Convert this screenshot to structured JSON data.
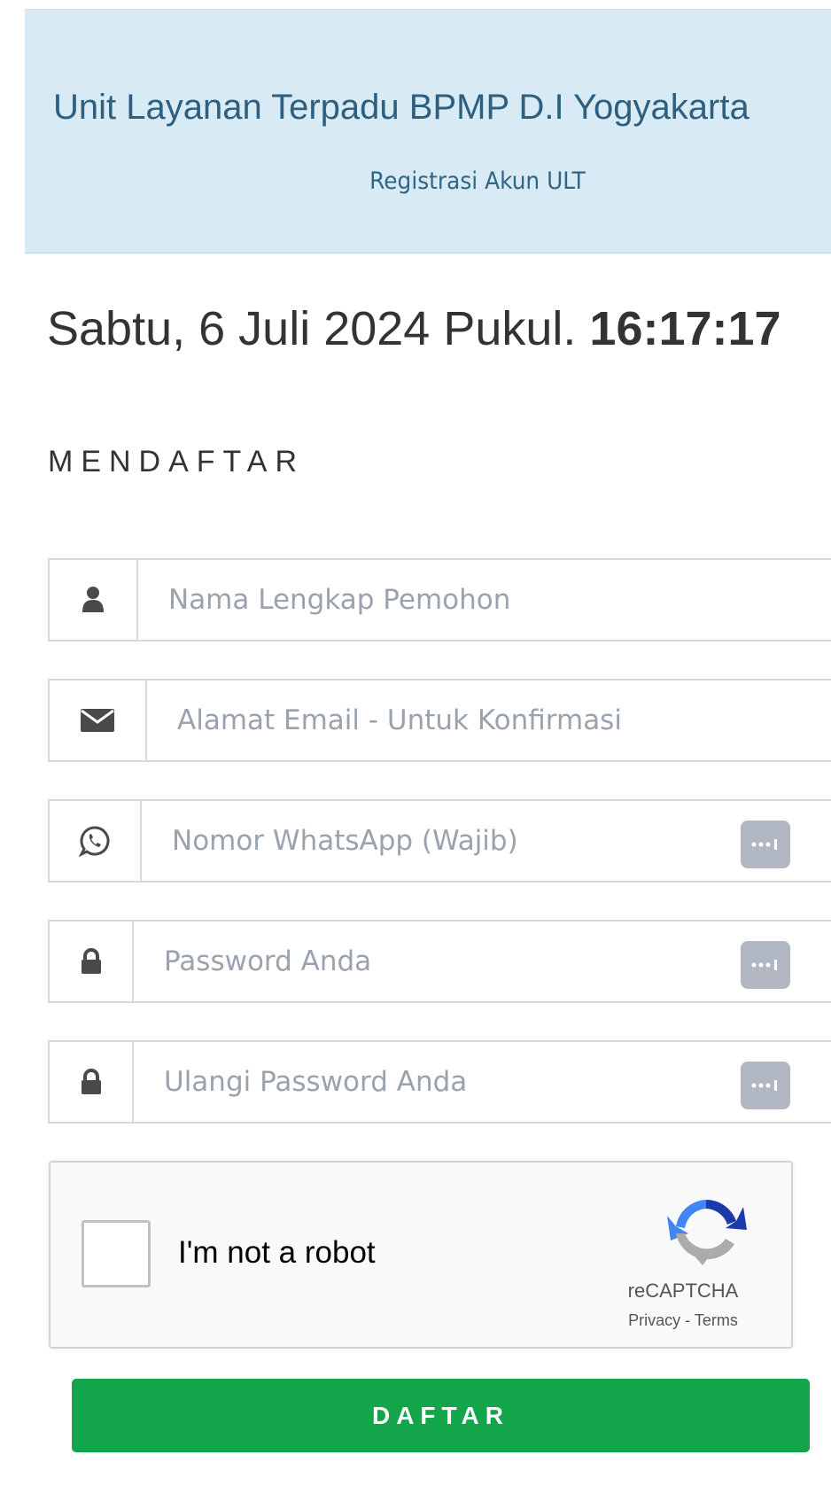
{
  "header": {
    "title": "Unit Layanan Terpadu BPMP D.I Yogyakarta",
    "subtitle": "Registrasi Akun ULT"
  },
  "datetime": {
    "date_text": "Sabtu, 6 Juli 2024 Pukul.",
    "time": "16:17:17"
  },
  "form": {
    "section_title": "MENDAFTAR",
    "fields": [
      {
        "placeholder": "Nama Lengkap Pemohon",
        "icon": "user-icon"
      },
      {
        "placeholder": "Alamat Email - Untuk Konfirmasi",
        "icon": "envelope-icon"
      },
      {
        "placeholder": "Nomor WhatsApp (Wajib)",
        "icon": "whatsapp-icon"
      },
      {
        "placeholder": "Password Anda",
        "icon": "lock-icon"
      },
      {
        "placeholder": "Ulangi Password Anda",
        "icon": "lock-icon"
      }
    ],
    "submit_label": "DAFTAR"
  },
  "captcha": {
    "label": "I'm not a robot",
    "brand": "reCAPTCHA",
    "links": "Privacy - Terms"
  },
  "colors": {
    "header_bg": "#d8eaf3",
    "header_text": "#2d5f80",
    "submit_bg": "#13a54a",
    "addon_icon": "#4a4a4a"
  }
}
